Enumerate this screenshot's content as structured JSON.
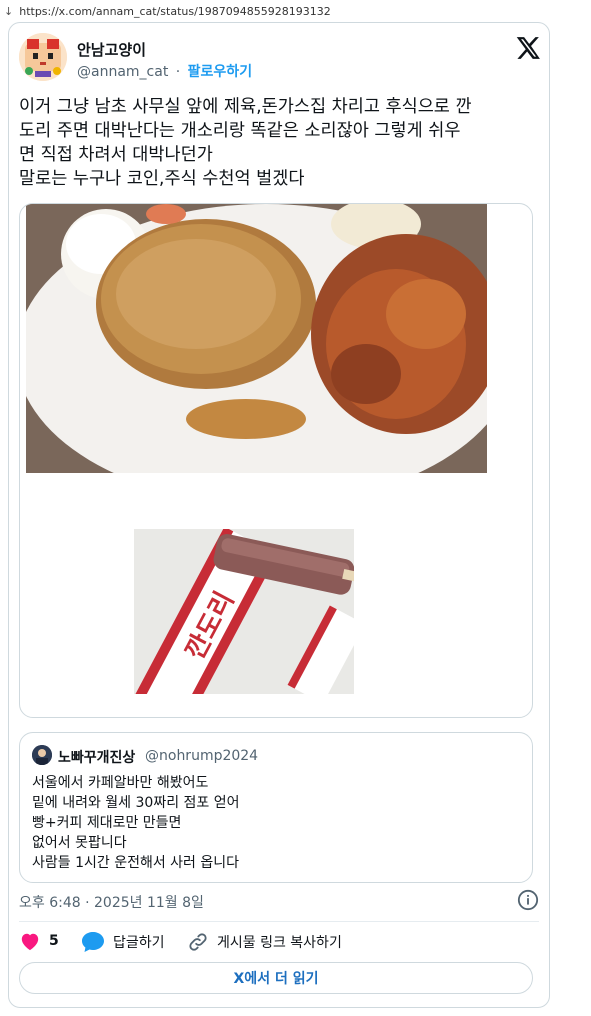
{
  "browser": {
    "arrow": "↓",
    "url": "https://x.com/annam_cat/status/1987094855928193132"
  },
  "author": {
    "name": "안남고양이",
    "handle": "@annam_cat",
    "separator": "·",
    "follow_label": "팔로우하기"
  },
  "tweet": {
    "lines": [
      "이거 그냥 남초 사무실 앞에 제육,돈가스집 차리고 후식으로 깐",
      "도리 주면 대박난다는 개소리랑 똑같은 소리잖아 그렇게 쉬우",
      "면 직접 차려서 대박나던가",
      "말로는 누구나 코인,주식 수천억 벌겠다"
    ]
  },
  "media": {
    "photo2_wrapper_text": "깐도리"
  },
  "quote": {
    "name": "노빠꾸개진상",
    "handle": "@nohrump2024",
    "lines": [
      "서울에서 카페알바만 해봤어도",
      "밑에 내려와 월세 30짜리 점포 얻어",
      "빵+커피 제대로만 만들면",
      "없어서 못팝니다",
      "사람들 1시간 운전해서 사러 옵니다"
    ]
  },
  "meta": {
    "timestamp": "오후 6:48 · 2025년 11월 8일"
  },
  "actions": {
    "like_count": "5",
    "reply_label": "답글하기",
    "copy_link_label": "게시물 링크 복사하기"
  },
  "read_more_label": "X에서 더 읽기",
  "colors": {
    "accent": "#1d9bf0",
    "like": "#f91880",
    "border": "#cfd9de",
    "muted": "#536471"
  }
}
